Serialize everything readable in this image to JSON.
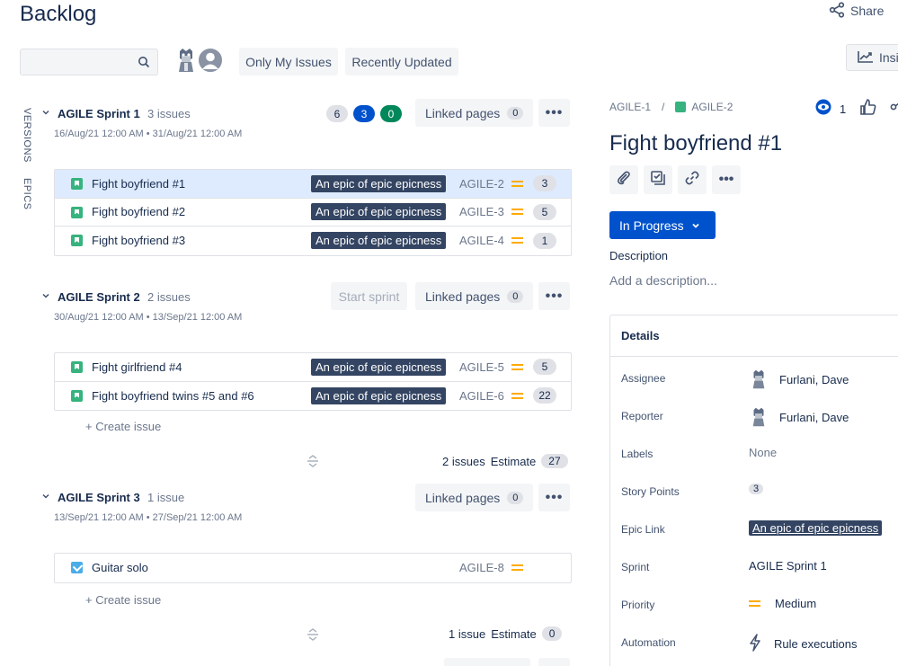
{
  "header": {
    "title": "Backlog",
    "share_label": "Share",
    "insights_label": "Insi"
  },
  "filters": {
    "search_placeholder": "",
    "only_my_issues": "Only My Issues",
    "recently_updated": "Recently Updated"
  },
  "side_tabs": {
    "versions": "VERSIONS",
    "epics": "EPICS"
  },
  "sprints": [
    {
      "name": "AGILE Sprint 1",
      "count": "3 issues",
      "dates": "16/Aug/21 12:00 AM • 31/Aug/21 12:00 AM",
      "status_counts": {
        "todo": "6",
        "in_progress": "3",
        "done": "0"
      },
      "linked_pages_label": "Linked pages",
      "linked_pages_count": "0",
      "issues": [
        {
          "summary": "Fight boyfriend #1",
          "epic": "An epic of epic epicness",
          "key": "AGILE-2",
          "estimate": "3"
        },
        {
          "summary": "Fight boyfriend #2",
          "epic": "An epic of epic epicness",
          "key": "AGILE-3",
          "estimate": "5"
        },
        {
          "summary": "Fight boyfriend #3",
          "epic": "An epic of epic epicness",
          "key": "AGILE-4",
          "estimate": "1"
        }
      ]
    },
    {
      "name": "AGILE Sprint 2",
      "count": "2 issues",
      "dates": "30/Aug/21 12:00 AM • 13/Sep/21 12:00 AM",
      "start_sprint_label": "Start sprint",
      "linked_pages_label": "Linked pages",
      "linked_pages_count": "0",
      "issues": [
        {
          "summary": "Fight girlfriend #4",
          "epic": "An epic of epic epicness",
          "key": "AGILE-5",
          "estimate": "5"
        },
        {
          "summary": "Fight boyfriend twins #5 and #6",
          "epic": "An epic of epic epicness",
          "key": "AGILE-6",
          "estimate": "22"
        }
      ],
      "create_issue": "+   Create issue",
      "footer_issues": "2 issues",
      "footer_estimate_label": "Estimate",
      "footer_estimate": "27"
    },
    {
      "name": "AGILE Sprint 3",
      "count": "1 issue",
      "dates": "13/Sep/21 12:00 AM • 27/Sep/21 12:00 AM",
      "linked_pages_label": "Linked pages",
      "linked_pages_count": "0",
      "issues": [
        {
          "summary": "Guitar solo",
          "key": "AGILE-8"
        }
      ],
      "create_issue": "+   Create issue",
      "footer_issues": "1 issue",
      "footer_estimate_label": "Estimate",
      "footer_estimate": "0"
    }
  ],
  "detail": {
    "breadcrumb_parent": "AGILE-1",
    "breadcrumb_sep": "/",
    "breadcrumb_current": "AGILE-2",
    "watchers": "1",
    "title": "Fight boyfriend #1",
    "status": "In Progress",
    "description_label": "Description",
    "description_placeholder": "Add a description...",
    "details_heading": "Details",
    "fields": {
      "assignee_label": "Assignee",
      "assignee": "Furlani, Dave",
      "reporter_label": "Reporter",
      "reporter": "Furlani, Dave",
      "labels_label": "Labels",
      "labels": "None",
      "story_points_label": "Story Points",
      "story_points": "3",
      "epic_link_label": "Epic Link",
      "epic_link": "An epic of epic epicness",
      "sprint_label": "Sprint",
      "sprint": "AGILE Sprint 1",
      "priority_label": "Priority",
      "priority": "Medium",
      "automation_label": "Automation",
      "automation": "Rule executions"
    }
  },
  "colors": {
    "accent": "#0052cc",
    "story": "#36b37e",
    "task": "#4bade8",
    "epic": "#344563",
    "priority_medium": "#ffab00",
    "done": "#00875a"
  }
}
